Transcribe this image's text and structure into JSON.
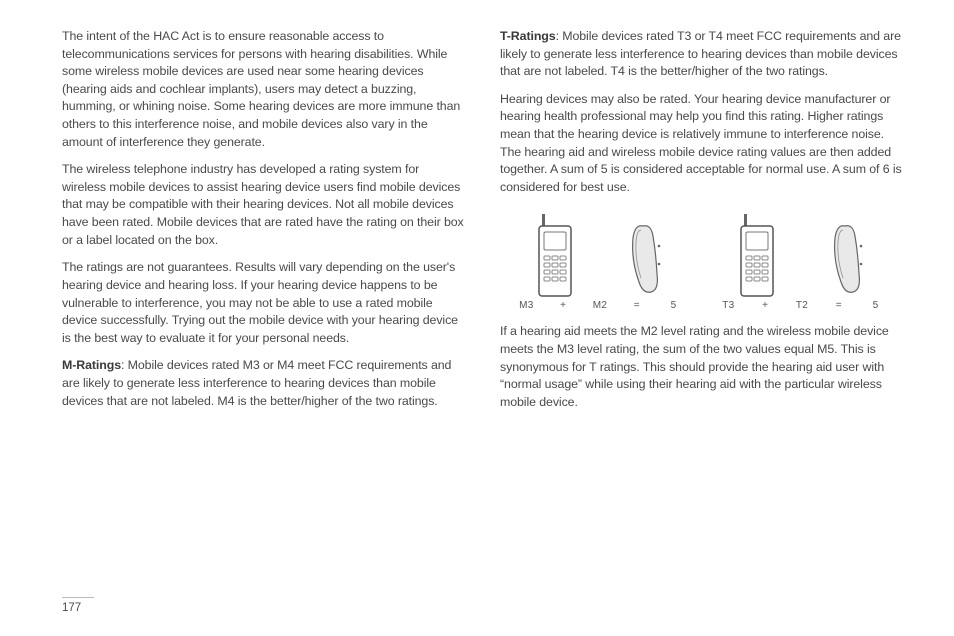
{
  "page_number": "177",
  "left": {
    "p1": "The intent of the HAC Act is to ensure reasonable access to telecommunications services for persons with hearing disabilities. While some wireless mobile devices are used near some hearing devices (hearing aids and cochlear implants), users may detect a buzzing, humming, or whining noise. Some hearing devices are more immune than others to this interference noise, and mobile devices also vary in the amount of interference they generate.",
    "p2": "The wireless telephone industry has developed a rating system for wireless mobile devices to assist hearing device users find mobile devices that may be compatible with their hearing devices. Not all mobile devices have been rated. Mobile devices that are rated have the rating on their box or a label located on the box.",
    "p3": "The ratings are not guarantees. Results will vary depending on the user's hearing device and hearing loss. If your hearing device happens to be vulnerable to interference, you may not be able to use a rated mobile device successfully. Trying out the mobile device with your hearing device is the best way to evaluate it for your personal needs.",
    "m_label": "M-Ratings",
    "m_text": ": Mobile devices rated M3 or M4 meet FCC requirements and are likely to generate less interference to hearing devices than mobile devices that are not labeled. M4 is the better/higher of the two ratings."
  },
  "right": {
    "t_label": "T-Ratings",
    "t_text": ": Mobile devices rated T3 or T4 meet FCC requirements and are likely to generate less interference to hearing devices than mobile devices that are not labeled. T4 is the better/higher of the two ratings.",
    "p2": "Hearing devices may also be rated. Your hearing device manufacturer or hearing health professional may help you find this rating. Higher ratings mean that the hearing device is relatively immune to interference noise. The hearing aid and wireless mobile device rating values are then added together. A sum of 5 is considered acceptable for normal use. A sum of 6 is considered for best use.",
    "p3": "If a hearing aid meets the M2 level rating and the wireless mobile device meets the M3 level rating, the sum of the two values equal M5. This is synonymous for T ratings. This should provide the hearing aid user with “normal usage” while using their hearing aid with the particular wireless mobile device.",
    "fig1": {
      "a": "M3",
      "plus": "+",
      "b": "M2",
      "eq": "=",
      "sum": "5"
    },
    "fig2": {
      "a": "T3",
      "plus": "+",
      "b": "T2",
      "eq": "=",
      "sum": "5"
    }
  }
}
